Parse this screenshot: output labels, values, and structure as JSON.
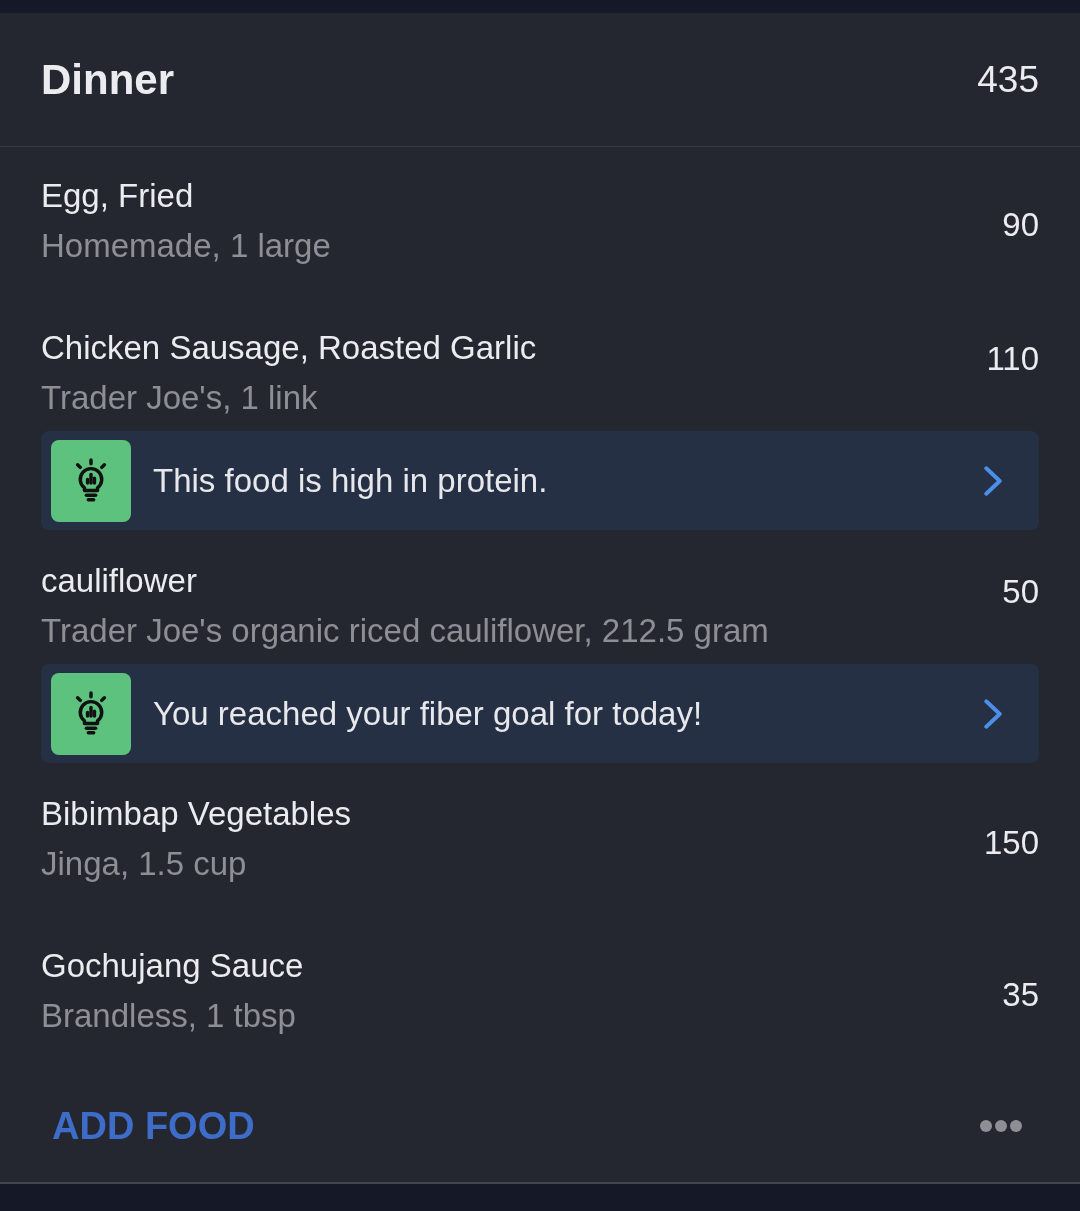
{
  "meal": {
    "title": "Dinner",
    "calories": "435"
  },
  "foods": [
    {
      "name": "Egg, Fried",
      "detail": "Homemade, 1 large",
      "calories": "90"
    },
    {
      "name": "Chicken Sausage, Roasted Garlic",
      "detail": "Trader Joe's, 1 link",
      "calories": "110",
      "insight": "This food is high in protein."
    },
    {
      "name": "cauliflower",
      "detail": "Trader Joe's organic riced cauliflower, 212.5 gram",
      "calories": "50",
      "insight": "You reached your fiber goal for today!"
    },
    {
      "name": "Bibimbap Vegetables",
      "detail": "Jinga, 1.5 cup",
      "calories": "150"
    },
    {
      "name": "Gochujang Sauce",
      "detail": "Brandless, 1 tbsp",
      "calories": "35"
    }
  ],
  "footer": {
    "add_button": "ADD FOOD"
  }
}
